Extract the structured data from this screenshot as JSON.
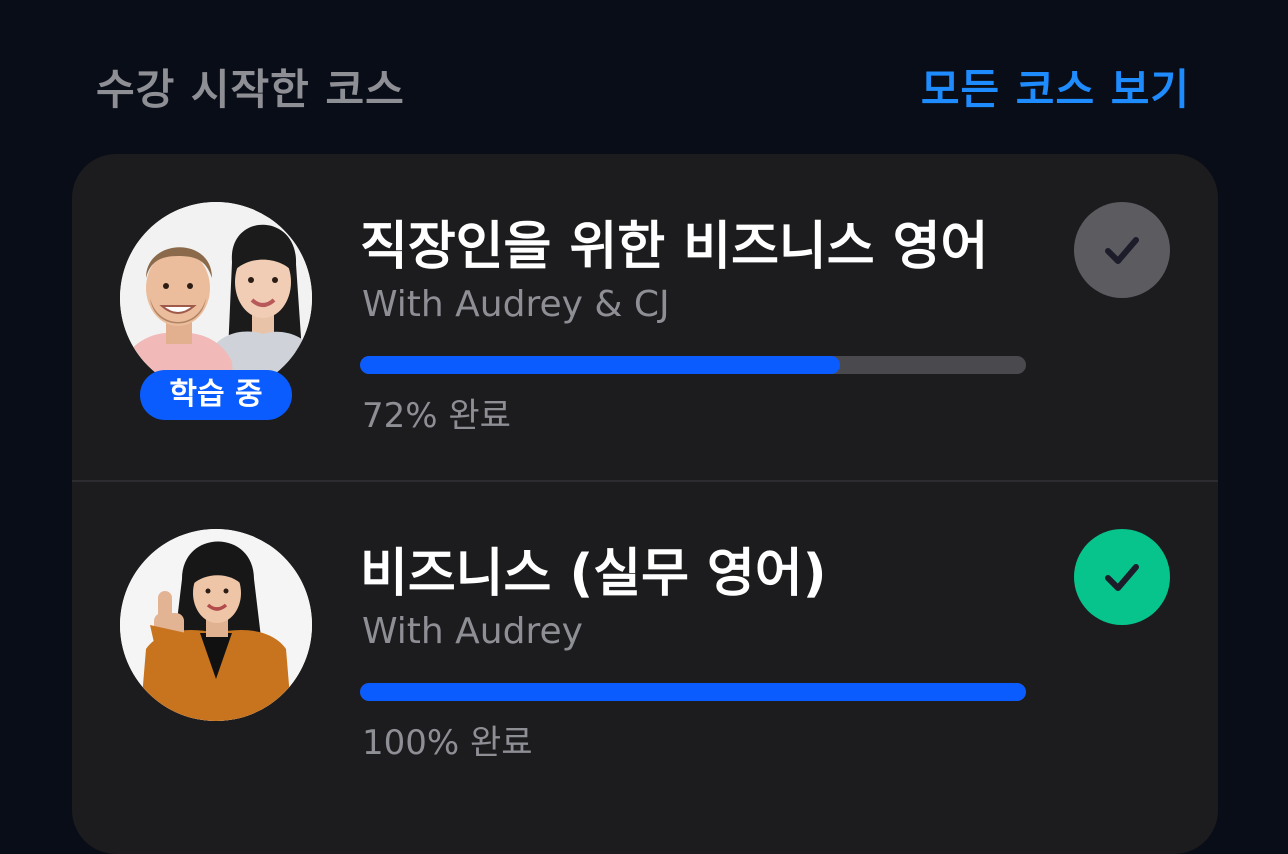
{
  "header": {
    "title": "수강 시작한 코스",
    "see_all_label": "모든 코스 보기"
  },
  "courses": [
    {
      "title": "직장인을 위한 비즈니스 영어",
      "instructor": "With Audrey & CJ",
      "status_badge": "학습 중",
      "progress": 0.72,
      "progress_label": "72% 완료",
      "check_state": "in-progress",
      "check_color": "#5b5b60"
    },
    {
      "title": "비즈니스 (실무 영어)",
      "instructor": "With Audrey",
      "progress": 1.0,
      "progress_label": "100% 완료",
      "check_state": "completed",
      "check_color": "#07c48c"
    }
  ],
  "colors": {
    "background": "#090d17",
    "card": "#1c1c1e",
    "accent": "#1e8bff",
    "progress": "#0a5cff",
    "muted_text": "#8e8e95"
  }
}
